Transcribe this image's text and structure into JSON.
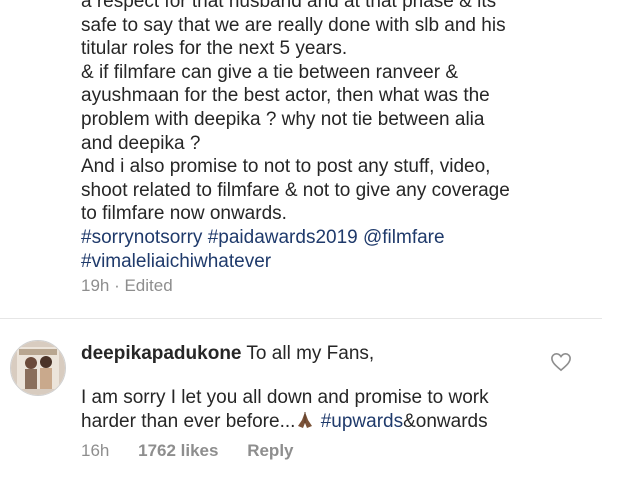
{
  "comment1": {
    "lines": [
      "a respect for that husband and at that phase & its",
      "safe to say that we are really done with slb and his",
      "titular roles for the next 5 years.",
      "& if filmfare can give a tie between ranveer &",
      "ayushmaan for the best actor, then what was the",
      "problem with deepika ? why not tie between alia",
      "and deepika ?",
      "And i also promise to not to post any stuff, video,",
      "shoot related to filmfare & not to give any coverage",
      "to filmfare now onwards."
    ],
    "hashtags_line1": "#sorrynotsorry #paidawards2019 @filmfare",
    "hashtags_line2": "#vimaleliaichiwhatever",
    "time": "19h · Edited"
  },
  "comment2": {
    "username": "deepikapadukone",
    "text_intro": " To all my Fans,",
    "text_line1": "I am sorry I let you all down and promise to work",
    "text_line2_start": "harder than ever before...",
    "emoji": "praying-hands",
    "hashtag": "#upwards",
    "text_line2_end": "&onwards",
    "time": "16h",
    "likes": "1762 likes",
    "reply_label": "Reply"
  },
  "colors": {
    "text": "#262626",
    "hashtag": "#1f3a6b",
    "meta": "#8e8e8e"
  }
}
